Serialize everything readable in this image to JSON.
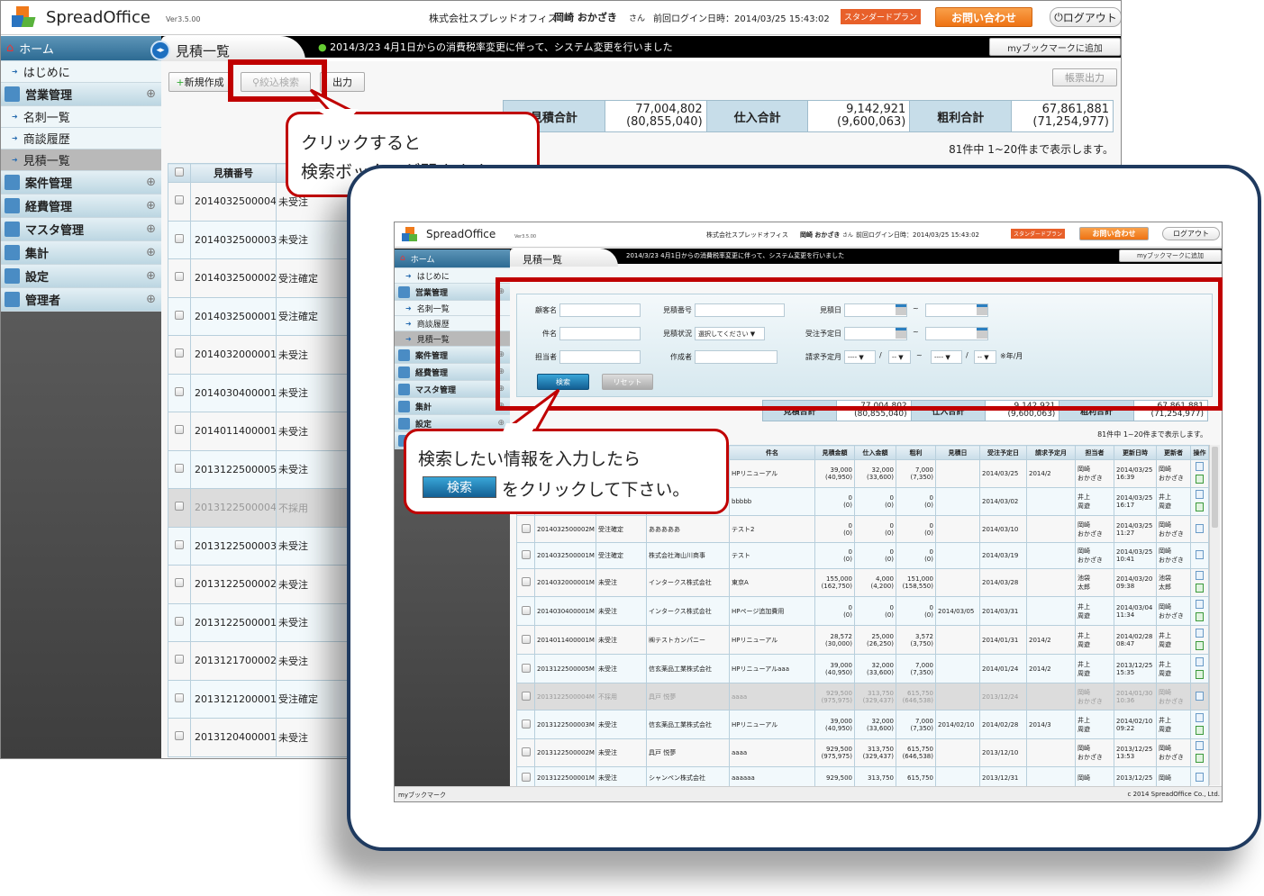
{
  "app": {
    "name": "SpreadOffice",
    "version": "Ver3.5.00",
    "company": "株式会社スプレッドオフィス",
    "user": "岡崎 おかざき",
    "user_suffix": "さん",
    "last_login": "前回ログイン日時：2014/03/25 15:43:02",
    "plan": "スタンダードプラン",
    "contact": "お問い合わせ",
    "logout": "ログアウト",
    "colors": {
      "accent": "#2d6b93",
      "callout": "#c00000",
      "contact": "#f07a1a",
      "frame": "#1f3a5f"
    }
  },
  "page": {
    "title": "見積一覧",
    "notice": "2014/3/23 4月1日からの消費税率変更に伴って、システム変更を行いました",
    "bookmark": "myブックマークに追加",
    "report": "帳票出力"
  },
  "toolbar": {
    "new": "新規作成",
    "filter": "絞込検索",
    "export": "出力"
  },
  "sidebar": {
    "home": "ホーム",
    "items": [
      {
        "label": "はじめに",
        "type": "sub"
      },
      {
        "label": "営業管理",
        "type": "cat",
        "icon": "sales-icon"
      },
      {
        "label": "名刺一覧",
        "type": "sub"
      },
      {
        "label": "商談履歴",
        "type": "sub"
      },
      {
        "label": "見積一覧",
        "type": "sub",
        "active": true
      },
      {
        "label": "案件管理",
        "type": "cat",
        "icon": "project-icon"
      },
      {
        "label": "経費管理",
        "type": "cat",
        "icon": "expense-icon"
      },
      {
        "label": "マスタ管理",
        "type": "cat",
        "icon": "master-icon"
      },
      {
        "label": "集計",
        "type": "cat",
        "icon": "pie-chart-icon"
      },
      {
        "label": "設定",
        "type": "cat",
        "icon": "settings-icon"
      },
      {
        "label": "管理者",
        "type": "cat",
        "icon": "admin-icon"
      }
    ]
  },
  "summary": {
    "estimate_label": "見積合計",
    "estimate": "77,004,802\n(80,855,040)",
    "purchase_label": "仕入合計",
    "purchase": "9,142,921\n(9,600,063)",
    "profit_label": "粗利合計",
    "profit": "67,861,881\n(71,254,977)",
    "count": "81件中 1~20件まで表示します。"
  },
  "back_table": {
    "header": "見積番号",
    "rows": [
      [
        "2014032500004M",
        "未受注"
      ],
      [
        "2014032500003M",
        "未受注"
      ],
      [
        "2014032500002M",
        "受注確定"
      ],
      [
        "2014032500001M",
        "受注確定"
      ],
      [
        "2014032000001M",
        "未受注"
      ],
      [
        "2014030400001M",
        "未受注"
      ],
      [
        "2014011400001M",
        "未受注"
      ],
      [
        "2013122500005M",
        "未受注"
      ],
      [
        "2013122500004M",
        "不採用"
      ],
      [
        "2013122500003M",
        "未受注"
      ],
      [
        "2013122500002M",
        "未受注"
      ],
      [
        "2013122500001M",
        "未受注"
      ],
      [
        "2013121700002M",
        "未受注"
      ],
      [
        "2013121200001M",
        "受注確定"
      ],
      [
        "2013120400001M",
        "未受注"
      ]
    ]
  },
  "callouts": {
    "first": "クリックすると\n検索ボックスが開きます。",
    "second_line1": "検索したい情報を入力したら",
    "second_button": "検索",
    "second_line2": "をクリックして下さい。"
  },
  "search": {
    "customer": "顧客名",
    "number": "見積番号",
    "date": "見積日",
    "subject": "件名",
    "status": "見積状況",
    "status_value": "選択してください ▼",
    "order_date": "受注予定日",
    "owner": "担当者",
    "creator": "作成者",
    "billing": "請求予定月",
    "year_sel": "---- ▼",
    "month_sel": "-- ▼",
    "tilde": "~",
    "slash": "/",
    "unit": "※年/月",
    "search_btn": "検索",
    "reset_btn": "リセット"
  },
  "table": {
    "headers": [
      "件名",
      "見積金額",
      "仕入金額",
      "粗利",
      "見積日",
      "受注予定日",
      "請求予定月",
      "担当者",
      "更新日時",
      "更新者",
      "操作"
    ],
    "rows": [
      {
        "c": [
          "",
          "",
          "",
          "HPリニューアル",
          "39,000\n(40,950)",
          "32,000\n(33,600)",
          "7,000\n(7,350)",
          "",
          "2014/03/25",
          "2014/2",
          "岡崎\nおかざき",
          "2014/03/25\n16:39",
          "岡崎\nおかざき"
        ],
        "edit": true
      },
      {
        "c": [
          "",
          "",
          "",
          "bbbbb",
          "0\n(0)",
          "0\n(0)",
          "0\n(0)",
          "",
          "2014/03/02",
          "",
          "井上\n周遊",
          "2014/03/25\n16:17",
          "井上\n周遊"
        ],
        "edit": true
      },
      {
        "c": [
          "2014032500002M",
          "受注確定",
          "あああああ",
          "テスト2",
          "0\n(0)",
          "0\n(0)",
          "0\n(0)",
          "",
          "2014/03/10",
          "",
          "岡崎\nおかざき",
          "2014/03/25\n11:27",
          "岡崎\nおかざき"
        ],
        "edit": false
      },
      {
        "c": [
          "2014032500001M",
          "受注確定",
          "株式会社海山川商事",
          "テスト",
          "0\n(0)",
          "0\n(0)",
          "0\n(0)",
          "",
          "2014/03/19",
          "",
          "岡崎\nおかざき",
          "2014/03/25\n10:41",
          "岡崎\nおかざき"
        ],
        "edit": false
      },
      {
        "c": [
          "2014032000001M",
          "未受注",
          "インタークス株式会社",
          "東京A",
          "155,000\n(162,750)",
          "4,000\n(4,200)",
          "151,000\n(158,550)",
          "",
          "2014/03/28",
          "",
          "池袋\n太郎",
          "2014/03/20\n09:38",
          "池袋\n太郎"
        ],
        "edit": true
      },
      {
        "c": [
          "2014030400001M",
          "未受注",
          "インタークス株式会社",
          "HPページ追加費用",
          "0\n(0)",
          "0\n(0)",
          "0\n(0)",
          "2014/03/05",
          "2014/03/31",
          "",
          "井上\n周遊",
          "2014/03/04\n11:34",
          "岡崎\nおかざき"
        ],
        "edit": true
      },
      {
        "c": [
          "2014011400001M",
          "未受注",
          "㈱テストカンパニー",
          "HPリニューアル",
          "28,572\n(30,000)",
          "25,000\n(26,250)",
          "3,572\n(3,750)",
          "",
          "2014/01/31",
          "2014/2",
          "井上\n周遊",
          "2014/02/28\n08:47",
          "井上\n周遊"
        ],
        "edit": true
      },
      {
        "c": [
          "2013122500005M",
          "未受注",
          "信玄薬品工業株式会社",
          "HPリニューアルaaa",
          "39,000\n(40,950)",
          "32,000\n(33,600)",
          "7,000\n(7,350)",
          "",
          "2014/01/24",
          "2014/2",
          "井上\n周遊",
          "2013/12/25\n15:35",
          "井上\n周遊"
        ],
        "edit": true
      },
      {
        "c": [
          "2013122500004M",
          "不採用",
          "具戸 悦夢",
          "aaaa",
          "929,500\n(975,975)",
          "313,750\n(329,437)",
          "615,750\n(646,538)",
          "",
          "2013/12/24",
          "",
          "岡崎\nおかざき",
          "2014/01/30\n10:36",
          "岡崎\nおかざき"
        ],
        "edit": false,
        "gray": true
      },
      {
        "c": [
          "2013122500003M",
          "未受注",
          "信玄薬品工業株式会社",
          "HPリニューアル",
          "39,000\n(40,950)",
          "32,000\n(33,600)",
          "7,000\n(7,350)",
          "2014/02/10",
          "2014/02/28",
          "2014/3",
          "井上\n周遊",
          "2014/02/10\n09:22",
          "井上\n周遊"
        ],
        "edit": true
      },
      {
        "c": [
          "2013122500002M",
          "未受注",
          "具戸 悦夢",
          "aaaa",
          "929,500\n(975,975)",
          "313,750\n(329,437)",
          "615,750\n(646,538)",
          "",
          "2013/12/10",
          "",
          "岡崎\nおかざき",
          "2013/12/25\n13:53",
          "岡崎\nおかざき"
        ],
        "edit": true
      },
      {
        "c": [
          "2013122500001M",
          "未受注",
          "シャンペン株式会社",
          "aaaaaa",
          "929,500",
          "313,750",
          "615,750",
          "",
          "2013/12/31",
          "",
          "岡崎",
          "2013/12/25",
          "岡崎"
        ],
        "edit": false
      }
    ]
  },
  "footer": {
    "bookmark": "myブックマーク",
    "copyright": "c 2014 SpreadOffice Co., Ltd."
  }
}
